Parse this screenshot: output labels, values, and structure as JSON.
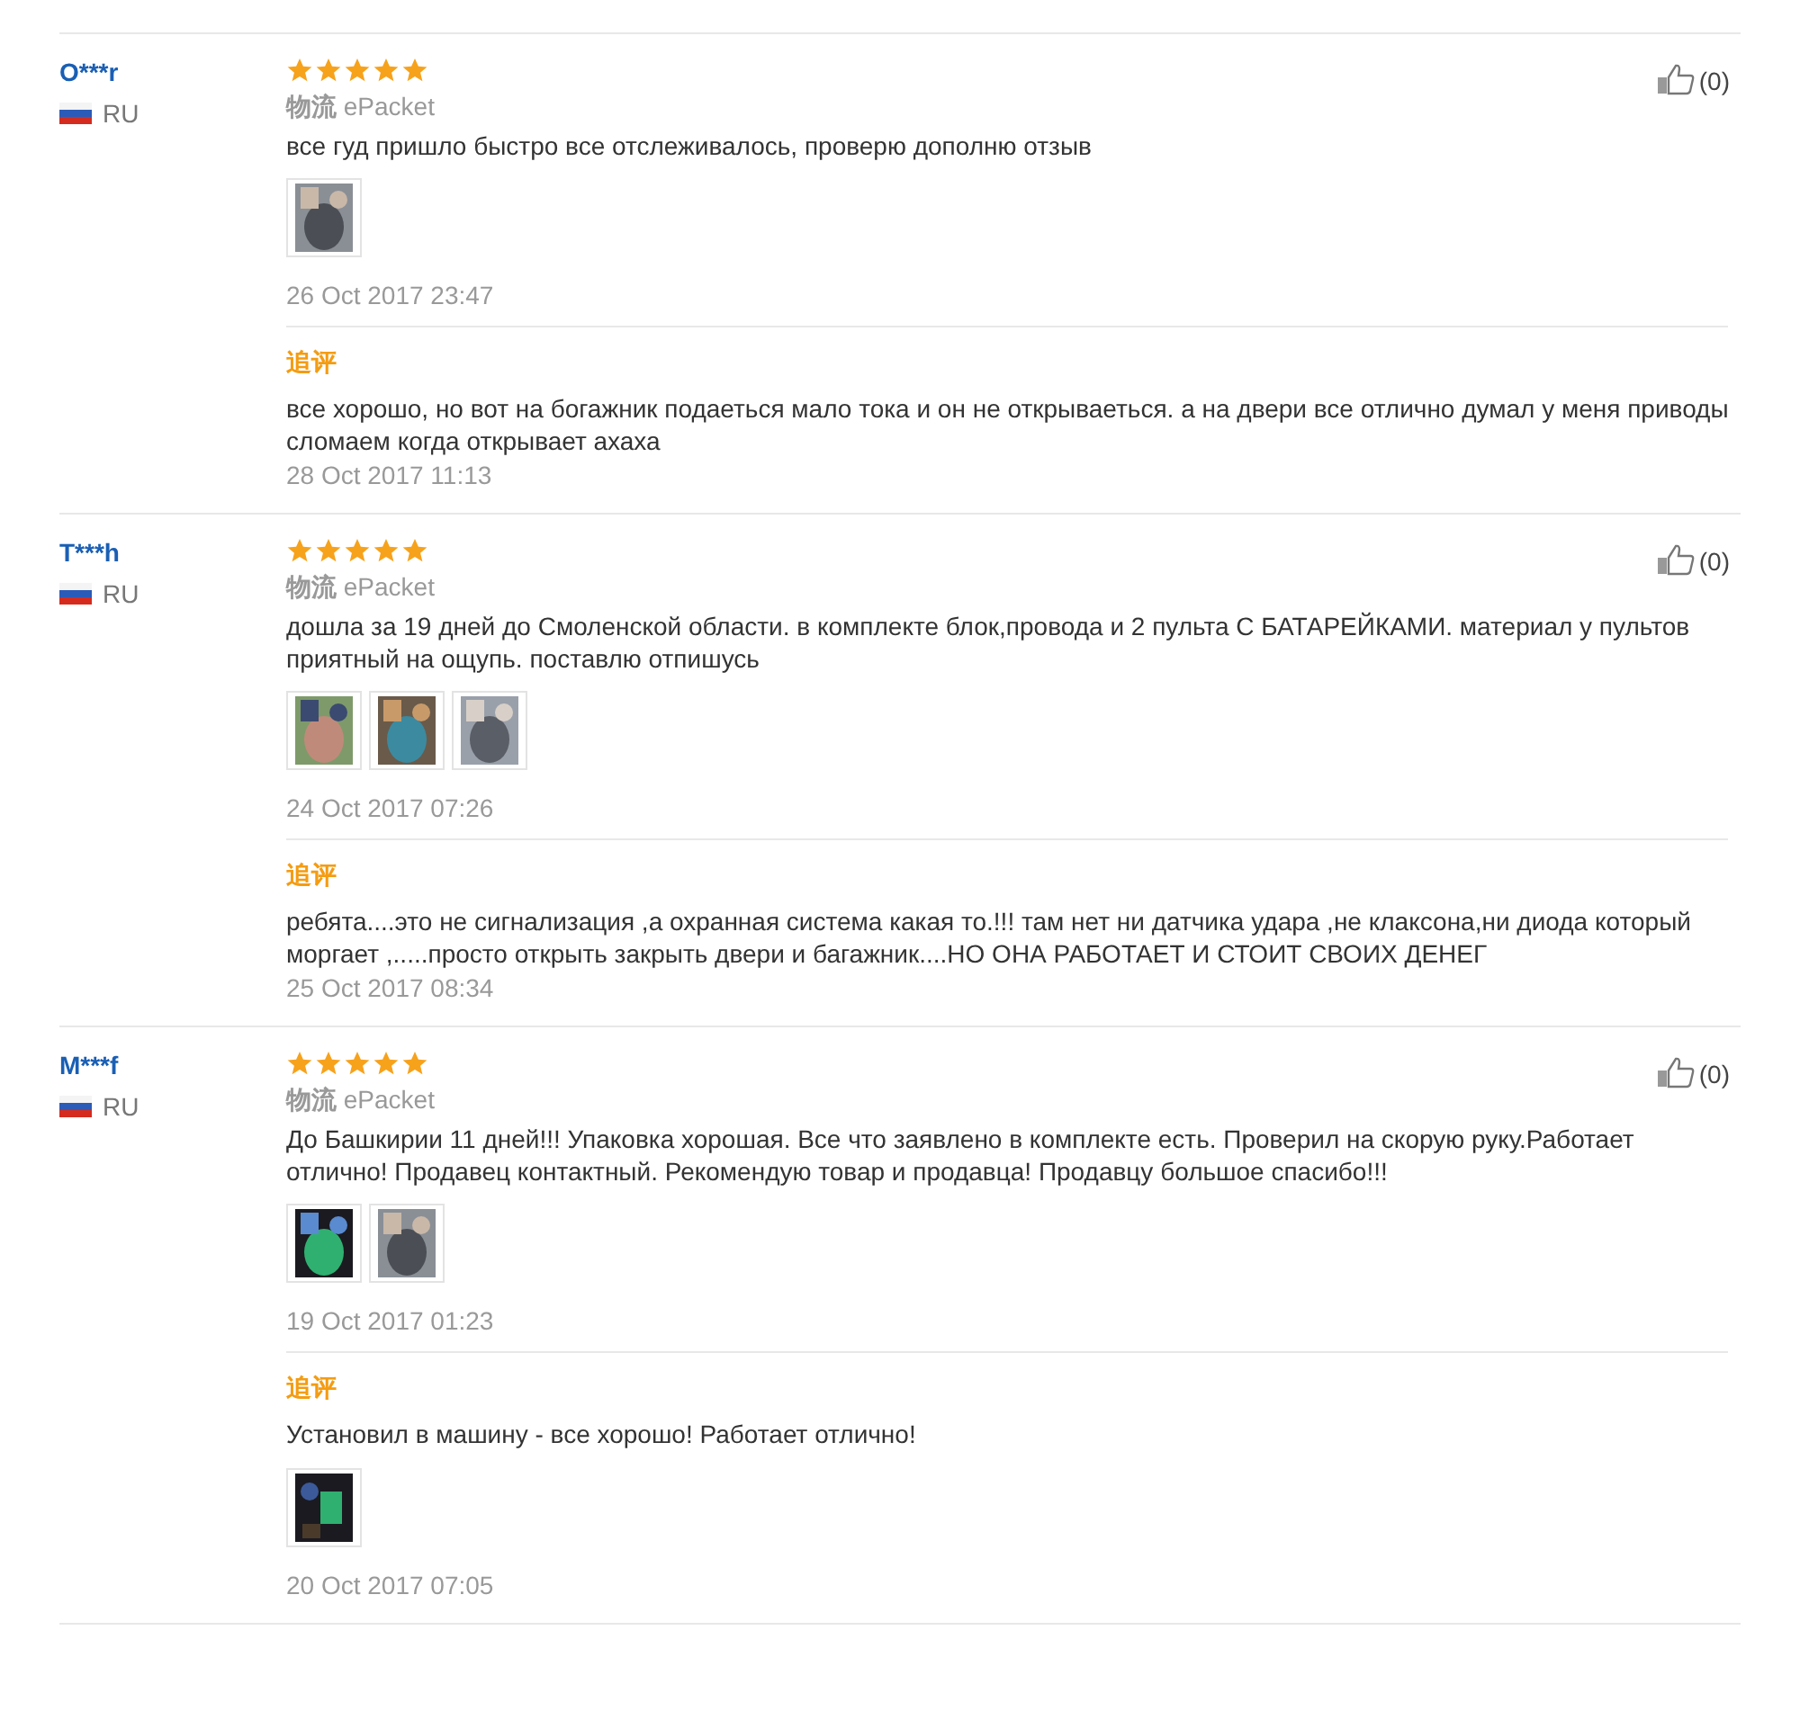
{
  "reviews": [
    {
      "name": "O***r",
      "country": "RU",
      "stars": 5,
      "shipping_label": "物流",
      "shipping": "ePacket",
      "likes": "(0)",
      "text": "все гуд пришло быстро все отслеживалось, проверю дополню отзыв",
      "photos": [
        {
          "kind": "picture"
        }
      ],
      "date": "26 Oct 2017 23:47",
      "followup": {
        "label": "追评",
        "text": "все хорошо, но вот на богажник подаеться мало тока и он не открываеться. а на двери все отлично думал у меня приводы сломаем когда открывает ахаха",
        "date": "28 Oct 2017 11:13"
      }
    },
    {
      "name": "T***h",
      "country": "RU",
      "stars": 5,
      "shipping_label": "物流",
      "shipping": "ePacket",
      "likes": "(0)",
      "text": "дошла за 19 дней до Смоленской области. в комплекте блок,провода и 2 пульта С БАТАРЕЙКАМИ. материал у пультов приятный на ощупь. поставлю отпишусь",
      "photos": [
        {
          "kind": "picture"
        },
        {
          "kind": "picture"
        },
        {
          "kind": "picture"
        }
      ],
      "date": "24 Oct 2017 07:26",
      "followup": {
        "label": "追评",
        "text": "ребята....это не сигнализация ,а охранная система какая то.!!! там нет ни датчика удара ,не клаксона,ни диода который моргает ,.....просто открыть закрыть двери и багажник....НО ОНА РАБОТАЕТ И СТОИТ СВОИХ ДЕНЕГ",
        "date": "25 Oct 2017 08:34"
      }
    },
    {
      "name": "M***f",
      "country": "RU",
      "stars": 5,
      "shipping_label": "物流",
      "shipping": "ePacket",
      "likes": "(0)",
      "text": "До Башкирии 11 дней!!! Упаковка хорошая. Все что заявлено в комплекте есть. Проверил на скорую руку.Работает отлично! Продавец контактный. Рекомендую товар и продавца! Продавцу большое спасибо!!!",
      "photos": [
        {
          "kind": "picture"
        },
        {
          "kind": "picture"
        }
      ],
      "date": "19 Oct 2017 01:23",
      "followup": {
        "label": "追评",
        "text": "Установил в машину - все хорошо! Работает отлично!",
        "photos": [
          {
            "kind": "picture"
          }
        ],
        "date": "20 Oct 2017 07:05"
      }
    }
  ]
}
